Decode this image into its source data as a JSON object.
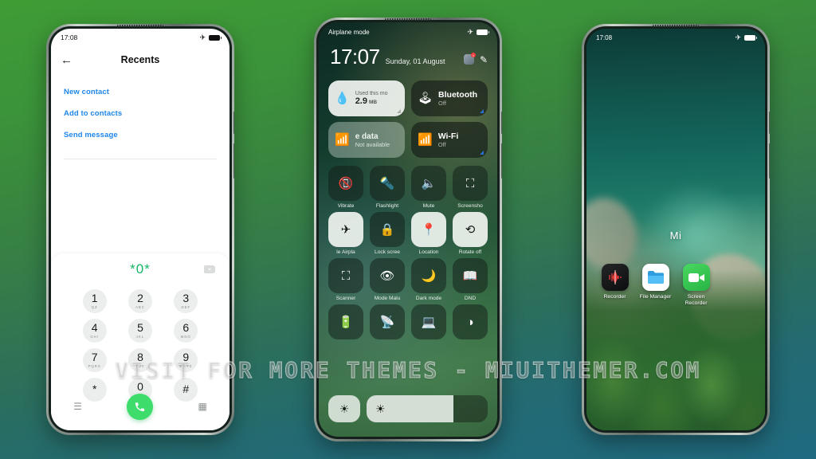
{
  "background": {
    "top_color": "#3f9c35",
    "bottom_color": "#1f6a80"
  },
  "watermark": {
    "text": "VISIT FOR MORE THEMES - MIUITHEMER.COM"
  },
  "phone_left": {
    "status": {
      "time": "17:08",
      "airplane_icon": "airplane-icon",
      "battery_icon": "battery-icon"
    },
    "header": {
      "back_icon": "back-arrow-icon",
      "title": "Recents"
    },
    "links": [
      {
        "label": "New contact"
      },
      {
        "label": "Add to contacts"
      },
      {
        "label": "Send message"
      }
    ],
    "dialpad": {
      "dialed_number": "*0*",
      "backspace_icon": "backspace-icon",
      "accent_color": "#15b765",
      "keys": [
        {
          "digit": "1",
          "letters": "QZ"
        },
        {
          "digit": "2",
          "letters": "ABC"
        },
        {
          "digit": "3",
          "letters": "DEF"
        },
        {
          "digit": "4",
          "letters": "GHI"
        },
        {
          "digit": "5",
          "letters": "JKL"
        },
        {
          "digit": "6",
          "letters": "MNO"
        },
        {
          "digit": "7",
          "letters": "PQRS"
        },
        {
          "digit": "8",
          "letters": "TUV"
        },
        {
          "digit": "9",
          "letters": "WXYZ"
        },
        {
          "digit": "*",
          "letters": ""
        },
        {
          "digit": "0",
          "letters": "+"
        },
        {
          "digit": "#",
          "letters": ""
        }
      ],
      "actions": {
        "menu_icon": "menu-icon",
        "call_icon": "call-icon",
        "keypad_icon": "keypad-icon",
        "call_color": "#3ddc6b"
      }
    }
  },
  "phone_center": {
    "status": {
      "label": "Airplane mode",
      "airplane_icon": "airplane-icon",
      "battery_icon": "battery-icon"
    },
    "clock": {
      "time": "17:07",
      "date": "Sunday, 01 August",
      "badge_count": "1",
      "edit_icon": "edit-icon"
    },
    "big_tiles": [
      {
        "name": "data-usage",
        "style": "light",
        "icon": "water-drop-icon",
        "caption": "Used this mo",
        "value": "2.9",
        "unit": "MB"
      },
      {
        "name": "bluetooth",
        "style": "dark",
        "icon": "bluetooth-icon",
        "title": "Bluetooth",
        "subtitle": "Off"
      }
    ],
    "row2_tiles": [
      {
        "name": "mobile-data",
        "style": "light",
        "icon": "signal-icon",
        "title": "e data",
        "subtitle": "Not available"
      },
      {
        "name": "wifi",
        "style": "dark",
        "icon": "wifi-off-icon",
        "title": "Wi-Fi",
        "subtitle": "Off"
      }
    ],
    "grid_a": [
      {
        "label": "Vibrate",
        "icon": "vibrate-icon",
        "state": "off"
      },
      {
        "label": "Flashlight",
        "icon": "flashlight-icon",
        "state": "off"
      },
      {
        "label": "Mute",
        "icon": "volume-icon",
        "state": "off"
      },
      {
        "label": "Screensho",
        "icon": "screenshot-icon",
        "state": "off"
      }
    ],
    "grid_b": [
      {
        "label": "le   Airpla",
        "icon": "airplane-icon",
        "state": "on"
      },
      {
        "label": "Lock scree",
        "icon": "lock-icon",
        "state": "off"
      },
      {
        "label": "Location",
        "icon": "location-pin-icon",
        "state": "on"
      },
      {
        "label": "Rotate off",
        "icon": "rotate-lock-icon",
        "state": "on"
      }
    ],
    "grid_c": [
      {
        "label": "Scanner",
        "icon": "scanner-icon",
        "state": "off"
      },
      {
        "label": "Mode Malu",
        "icon": "eye-off-icon",
        "state": "off"
      },
      {
        "label": "Dark mode",
        "icon": "moon-icon",
        "state": "off"
      },
      {
        "label": "DND",
        "icon": "book-icon",
        "state": "off"
      }
    ],
    "grid_d": [
      {
        "label": "",
        "icon": "battery-saver-icon",
        "state": "off"
      },
      {
        "label": "",
        "icon": "cast-icon",
        "state": "off"
      },
      {
        "label": "",
        "icon": "screen-cast-icon",
        "state": "off"
      },
      {
        "label": "",
        "icon": "contrast-icon",
        "state": "off"
      }
    ],
    "brightness": {
      "auto_icon": "brightness-auto-icon",
      "slider_icon": "brightness-icon",
      "level_percent": "72"
    }
  },
  "phone_right": {
    "status": {
      "time": "17:08",
      "airplane_icon": "airplane-icon",
      "battery_icon": "battery-icon"
    },
    "folder_label": "Mi",
    "apps": [
      {
        "label": "Recorder",
        "icon": "recorder-icon"
      },
      {
        "label": "File Manager",
        "icon": "folder-icon"
      },
      {
        "label": "Screen Recorder",
        "icon": "video-camera-icon"
      }
    ]
  }
}
